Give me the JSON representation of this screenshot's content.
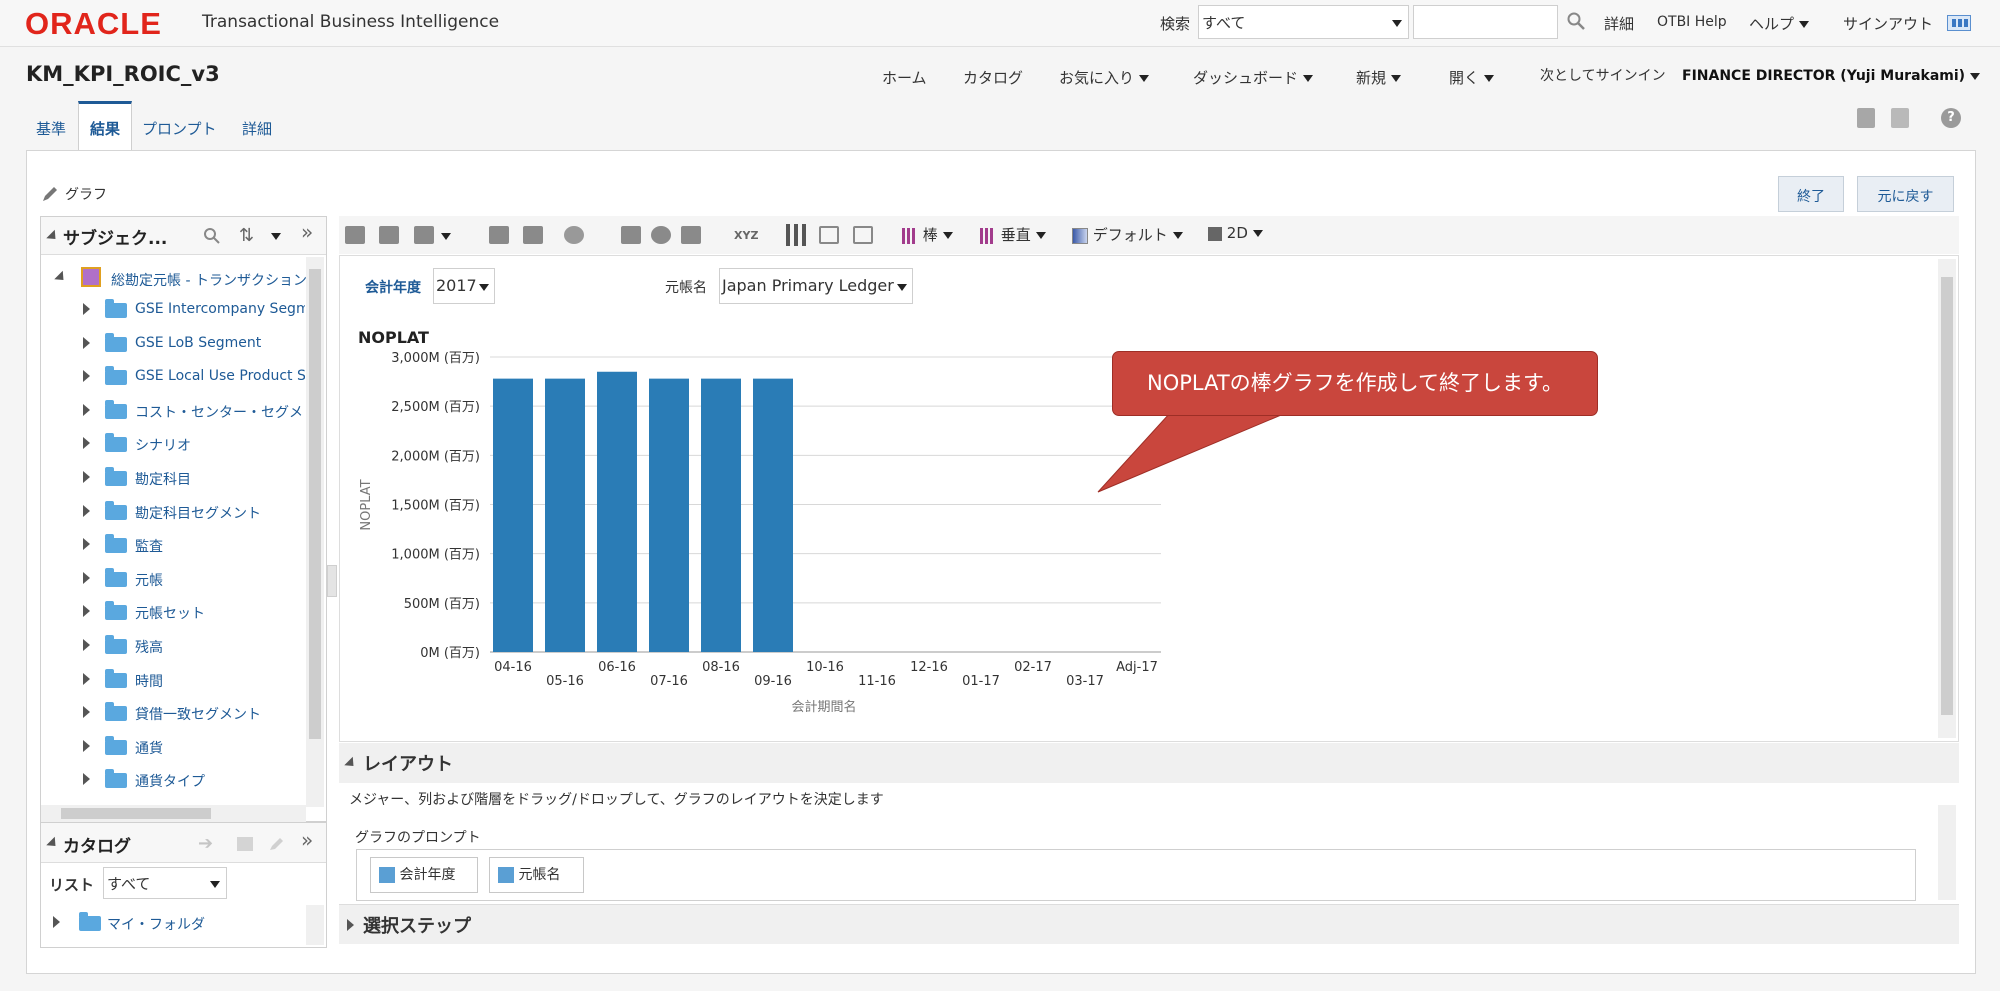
{
  "topbar": {
    "logo": "ORACLE",
    "app_name": "Transactional Business Intelligence",
    "search_label": "検索",
    "search_scope": "すべて",
    "search_value": "",
    "links": [
      "詳細",
      "OTBI Help",
      "ヘルプ",
      "サインアウト"
    ]
  },
  "header": {
    "title": "KM_KPI_ROIC_v3",
    "nav": [
      "ホーム",
      "カタログ",
      "お気に入り",
      "ダッシュボード",
      "新規",
      "開く"
    ],
    "signin_label": "次としてサインイン",
    "user": "FINANCE DIRECTOR (Yuji Murakami)"
  },
  "tabs": [
    "基準",
    "結果",
    "プロンプト",
    "詳細"
  ],
  "editor": {
    "section_label": "グラフ",
    "done_button": "終了",
    "revert_button": "元に戻す"
  },
  "subject_panel": {
    "title": "サブジェク...",
    "root": "総勘定元帳 - トランザクション",
    "items": [
      "GSE Intercompany Segme",
      "GSE LoB Segment",
      "GSE Local Use Product Se",
      "コスト・センター・セグメ",
      "シナリオ",
      "勘定科目",
      "勘定科目セグメント",
      "監査",
      "元帳",
      "元帳セット",
      "残高",
      "時間",
      "貸借一致セグメント",
      "通貨",
      "通貨タイプ"
    ]
  },
  "catalog_panel": {
    "title": "カタログ",
    "list_label": "リスト",
    "list_value": "すべて",
    "folder": "マイ・フォルダ"
  },
  "toolbar": {
    "chart_type": "棒",
    "orientation": "垂直",
    "style": "デフォルト",
    "dimension": "2D",
    "xyz": "XYZ"
  },
  "prompts": {
    "year_label": "会計年度",
    "year_value": "2017",
    "ledger_label": "元帳名",
    "ledger_value": "Japan Primary Ledger"
  },
  "callout": "NOPLATの棒グラフを作成して終了します。",
  "layout_section": {
    "title": "レイアウト",
    "hint": "メジャー、列および階層をドラッグ/ドロップして、グラフのレイアウトを決定します",
    "prompts_label": "グラフのプロンプト",
    "chips": [
      "会計年度",
      "元帳名"
    ]
  },
  "steps_section": {
    "title": "選択ステップ"
  },
  "chart_data": {
    "type": "bar",
    "title": "NOPLAT",
    "xlabel": "会計期間名",
    "ylabel": "NOPLAT",
    "categories": [
      "04-16",
      "05-16",
      "06-16",
      "07-16",
      "08-16",
      "09-16",
      "10-16",
      "11-16",
      "12-16",
      "01-17",
      "02-17",
      "03-17",
      "Adj-17"
    ],
    "values": [
      2780,
      2780,
      2850,
      2780,
      2780,
      2780,
      null,
      null,
      null,
      null,
      null,
      null,
      null
    ],
    "ylim": [
      0,
      3000
    ],
    "yticks": [
      "0M (百万)",
      "500M (百万)",
      "1,000M (百万)",
      "1,500M (百万)",
      "2,000M (百万)",
      "2,500M (百万)",
      "3,000M (百万)"
    ],
    "grid": true,
    "bar_color": "#2a7cb6"
  }
}
